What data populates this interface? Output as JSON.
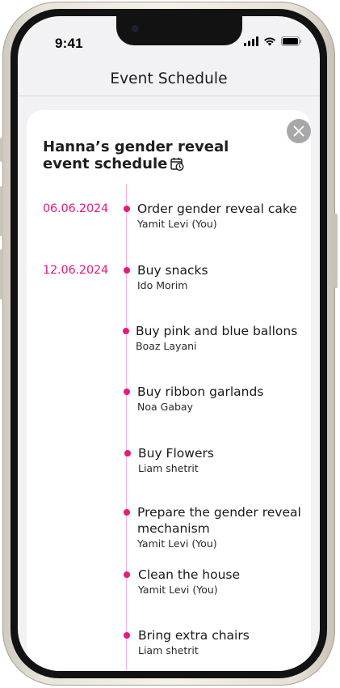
{
  "status_bar": {
    "time": "9:41"
  },
  "header": {
    "title": "Event Schedule"
  },
  "sheet": {
    "title": "Hanna’s gender reveal event schedule",
    "title_icon": "calendar-clock-icon",
    "close_icon": "close-icon"
  },
  "timeline": {
    "dates": [
      "06.06.2024",
      "12.06.2024"
    ],
    "tasks": [
      {
        "title": "Order gender reveal cake",
        "owner": "Yamit Levi (You)"
      },
      {
        "title": "Buy snacks",
        "owner": "Ido Morim"
      },
      {
        "title": "Buy pink and blue ballons",
        "owner": "Boaz Layani"
      },
      {
        "title": "Buy ribbon garlands",
        "owner": "Noa Gabay"
      },
      {
        "title": "Buy Flowers",
        "owner": "Liam shetrit"
      },
      {
        "title": "Prepare the gender reveal mechanism",
        "owner": "Yamit Levi (You)"
      },
      {
        "title": "Clean the house",
        "owner": "Yamit Levi (You)"
      },
      {
        "title": "Bring extra chairs",
        "owner": "Liam shetrit"
      }
    ]
  },
  "colors": {
    "accent": "#e5197e",
    "timeline_line": "#f3b7d6",
    "close_button": "#a8a8a8"
  }
}
